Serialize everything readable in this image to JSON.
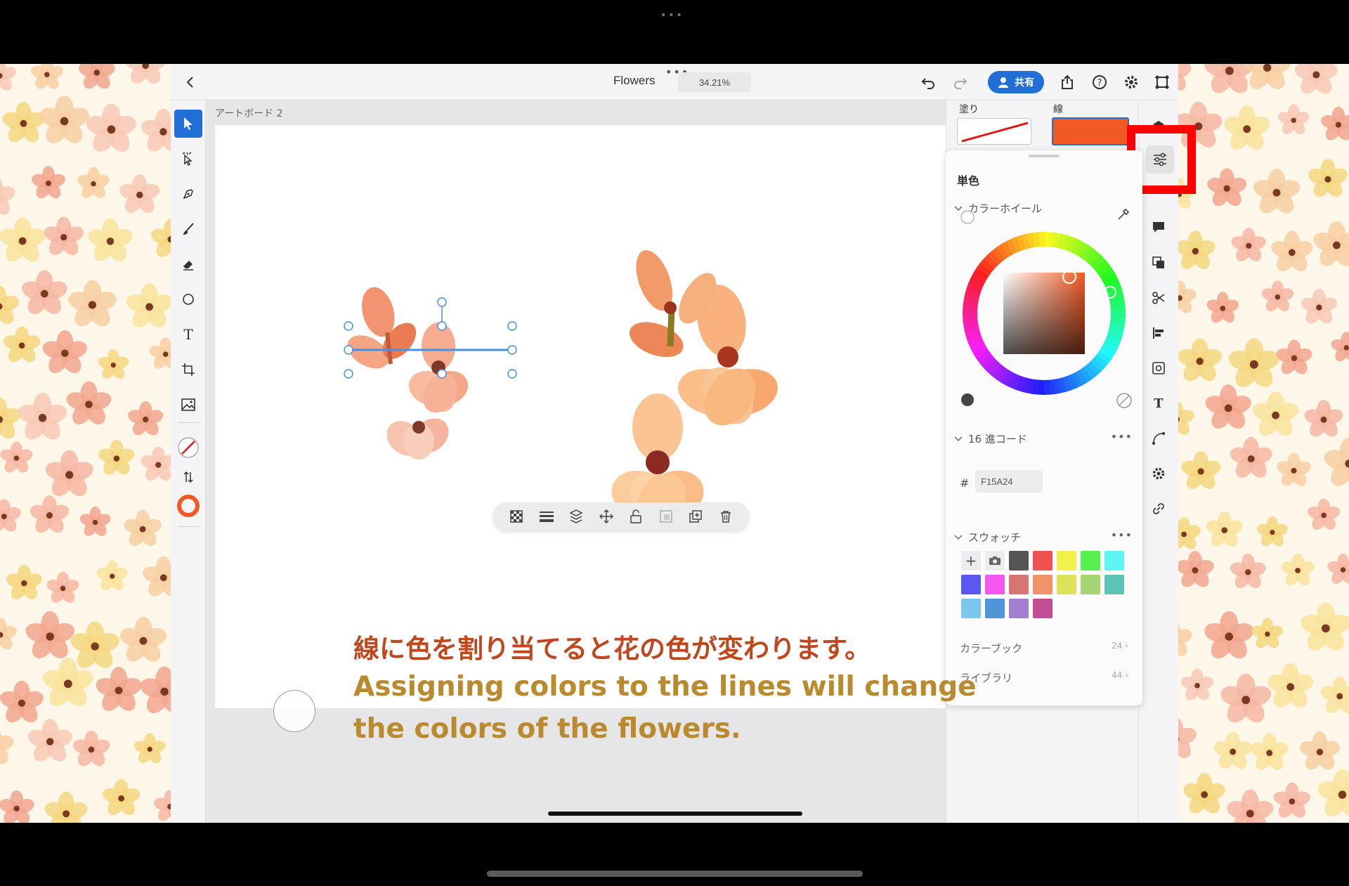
{
  "app": {
    "document_title": "Flowers",
    "zoom_level": "34.21%",
    "share_label": "共有",
    "artboard_label": "アートボード 2"
  },
  "colors": {
    "accent": "#1f6fd6",
    "stroke_color": "#f15a24",
    "highlight": "#ff0000",
    "caption_jp": "#c0461d",
    "caption_en": "#b98a2e"
  },
  "toolbar": {
    "tools": [
      "select",
      "direct-select",
      "pen",
      "brush",
      "eraser",
      "ellipse",
      "text",
      "crop",
      "image",
      "fill-none",
      "swap",
      "stroke"
    ],
    "text_tool_glyph": "T"
  },
  "context_toolbar": {
    "actions": [
      "transparency",
      "stroke-weight",
      "arrange",
      "move",
      "lock",
      "mask",
      "duplicate",
      "delete"
    ]
  },
  "properties": {
    "fill_label": "塗り",
    "stroke_label": "線",
    "mode_label": "単色",
    "color_wheel_label": "カラーホイール",
    "hex_label": "16 進コード",
    "hex_prefix": "#",
    "hex_value": "F15A24",
    "swatches_label": "スウォッチ",
    "add_glyph": "+",
    "more_glyph": "•••",
    "swatches": [
      "#555555",
      "#f05252",
      "#f4f04a",
      "#58f050",
      "#5cf6f4",
      "#5a58f0",
      "#f456ee",
      "#d97474",
      "#f0936a",
      "#dde25a",
      "#a6d673",
      "#5ec4b8",
      "#7cc7f0",
      "#4f95d8",
      "#a47ed0",
      "#c04d96"
    ],
    "color_book_label": "カラーブック",
    "color_book_count": "24",
    "library_label": "ライブラリ",
    "library_count": "44"
  },
  "caption": {
    "jp": "線に色を割り当てると花の色が変わります。",
    "en_line1": "Assigning colors to the lines will change",
    "en_line2": "the colors of the flowers."
  },
  "rail": {
    "icons": [
      "layers-icon",
      "properties-icon",
      "brush-settings-icon",
      "comment-icon",
      "boolean-icon",
      "scissors-icon",
      "align-icon",
      "repeat-icon",
      "type-icon",
      "path-icon",
      "settings-gear-icon",
      "link-icon"
    ],
    "type_glyph": "T"
  }
}
